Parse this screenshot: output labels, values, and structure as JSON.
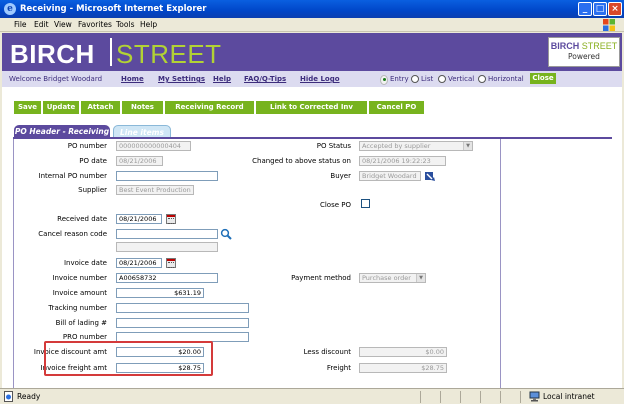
{
  "window": {
    "title": "Receiving - Microsoft Internet Explorer"
  },
  "menu": [
    "File",
    "Edit",
    "View",
    "Favorites",
    "Tools",
    "Help"
  ],
  "header": {
    "brand_left": "BIRCH",
    "brand_right": "STREET",
    "logo_line1_a": "BIRCH",
    "logo_line1_b": "STREET",
    "logo_line2": "Powered"
  },
  "nav": {
    "welcome": "Welcome Bridget Woodard",
    "links": [
      "Home",
      "My Settings",
      "Help",
      "FAQ/Q-Tips",
      "Hide Logo"
    ],
    "views": [
      "Entry",
      "List",
      "Vertical",
      "Horizontal"
    ],
    "selected_view": "Entry",
    "close": "Close"
  },
  "toolbar": [
    "Save",
    "Update",
    "Attach",
    "Notes",
    "Receiving Record",
    "Link to Corrected Inv",
    "Cancel PO"
  ],
  "tabs": {
    "active": "PO Header - Receiving",
    "other": "Line items"
  },
  "left_fields": [
    {
      "label": "PO number",
      "value": "000000000000404"
    },
    {
      "label": "PO date",
      "value": "08/21/2006"
    },
    {
      "label": "Internal PO number",
      "value": ""
    },
    {
      "label": "Supplier",
      "value": "Best Event Production"
    },
    {
      "label": "Received date",
      "value": "08/21/2006"
    },
    {
      "label": "Cancel reason code",
      "value": ""
    },
    {
      "label": "Invoice date",
      "value": "08/21/2006"
    },
    {
      "label": "Invoice number",
      "value": "A00658732"
    },
    {
      "label": "Invoice amount",
      "value": "$631.19"
    },
    {
      "label": "Tracking number",
      "value": ""
    },
    {
      "label": "Bill of lading #",
      "value": ""
    },
    {
      "label": "PRO number",
      "value": ""
    },
    {
      "label": "Invoice discount amt",
      "value": "$20.00"
    },
    {
      "label": "Invoice freight amt",
      "value": "$28.75"
    }
  ],
  "right_fields": [
    {
      "label": "PO Status",
      "value": "Accepted by supplier"
    },
    {
      "label": "Changed to above status on",
      "value": "08/21/2006 19:22:23"
    },
    {
      "label": "Buyer",
      "value": "Bridget Woodard"
    },
    {
      "label": "Close PO",
      "value": ""
    },
    {
      "label": "Payment method",
      "value": "Purchase order"
    },
    {
      "label": "Less discount",
      "value": "$0.00"
    },
    {
      "label": "Freight",
      "value": "$28.75"
    }
  ],
  "status": {
    "left": "Ready",
    "zone": "Local intranet"
  }
}
